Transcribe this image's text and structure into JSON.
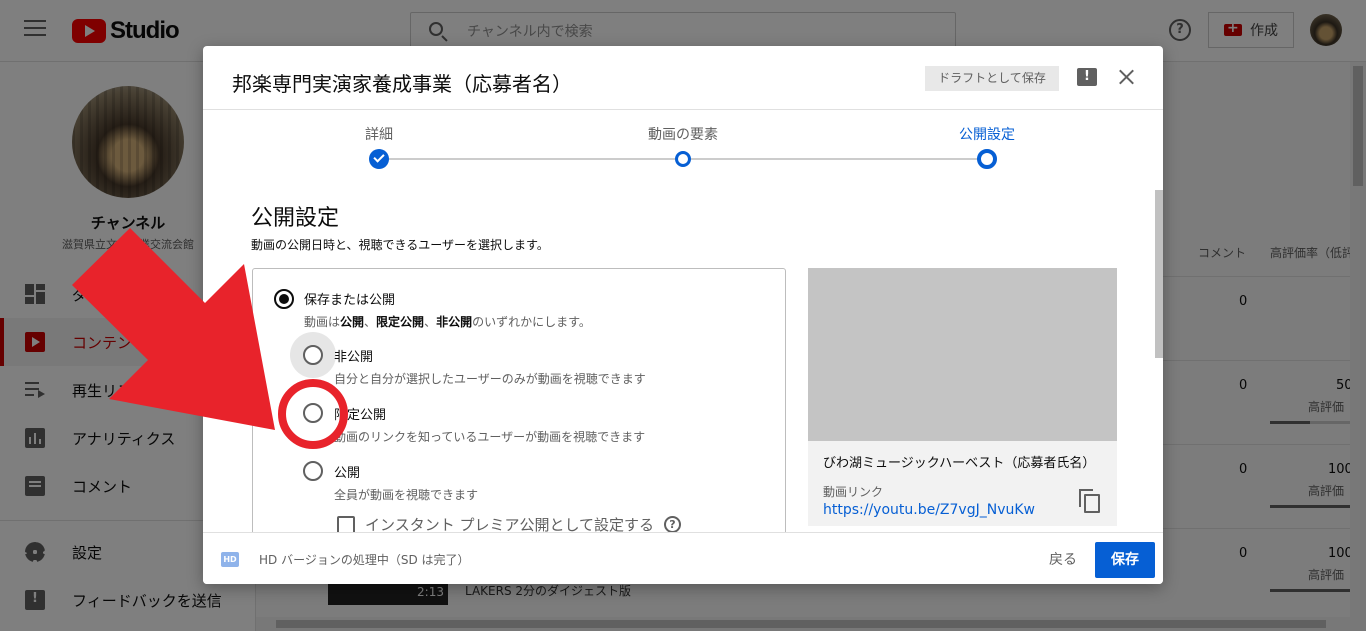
{
  "header": {
    "logo_text": "Studio",
    "search_placeholder": "チャンネル内で検索",
    "create_label": "作成"
  },
  "sidebar": {
    "channel_name": "チャンネル",
    "channel_sub": "滋賀県立文化産業交流会館",
    "items": [
      {
        "label": "ダッシュボード",
        "icon": "dashboard-icon"
      },
      {
        "label": "コンテンツ",
        "icon": "content-icon",
        "active": true
      },
      {
        "label": "再生リスト",
        "icon": "playlist-icon"
      },
      {
        "label": "アナリティクス",
        "icon": "analytics-icon"
      },
      {
        "label": "コメント",
        "icon": "comment-icon"
      },
      {
        "label": "設定",
        "icon": "settings-icon"
      },
      {
        "label": "フィードバックを送信",
        "icon": "feedback-icon"
      }
    ]
  },
  "table": {
    "columns": [
      "コメント",
      "高評価率（低評価比）"
    ],
    "rows": [
      {
        "comments": "0",
        "rating": "",
        "rating_label": "",
        "rating_fill": 0
      },
      {
        "comments": "0",
        "rating": "50",
        "rating_label": "高評価",
        "rating_fill": 0.5
      },
      {
        "comments": "0",
        "rating": "100",
        "rating_label": "高評価",
        "rating_fill": 1.0
      },
      {
        "comments": "0",
        "rating": "100",
        "rating_label": "高評価",
        "rating_fill": 1.0
      }
    ],
    "bottom_video_duration": "2:13",
    "bottom_video_title": "LAKERS 2分のダイジェスト版"
  },
  "dialog": {
    "title": "邦楽専門実演家養成事業（応募者名）",
    "draft_label": "ドラフトとして保存",
    "steps": [
      {
        "label": "詳細",
        "state": "done"
      },
      {
        "label": "動画の要素",
        "state": "done"
      },
      {
        "label": "公開設定",
        "state": "current"
      }
    ],
    "section_title": "公開設定",
    "section_desc": "動画の公開日時と、視聴できるユーザーを選択します。",
    "main_option": {
      "label": "保存または公開",
      "sub_prefix": "動画は",
      "sub_b1": "公開",
      "sub_sep1": "、",
      "sub_b2": "限定公開",
      "sub_sep2": "、",
      "sub_b3": "非公開",
      "sub_suffix": "のいずれかにします。",
      "checked": true
    },
    "options": [
      {
        "label": "非公開",
        "sub": "自分と自分が選択したユーザーのみが動画を視聴できます"
      },
      {
        "label": "限定公開",
        "sub": "動画のリンクを知っているユーザーが動画を視聴できます"
      },
      {
        "label": "公開",
        "sub": "全員が動画を視聴できます"
      }
    ],
    "premiere_label": "インスタント プレミア公開として設定する",
    "preview": {
      "title": "びわ湖ミュージックハーベスト（応募者氏名）",
      "link_label": "動画リンク",
      "link": "https://youtu.be/Z7vgJ_NvuKw"
    },
    "footer": {
      "hd_badge": "HD",
      "status": "HD バージョンの処理中（SD は完了）",
      "back_label": "戻る",
      "save_label": "保存"
    }
  },
  "colors": {
    "accent": "#065fd4",
    "annotation_red": "#e8232b"
  }
}
